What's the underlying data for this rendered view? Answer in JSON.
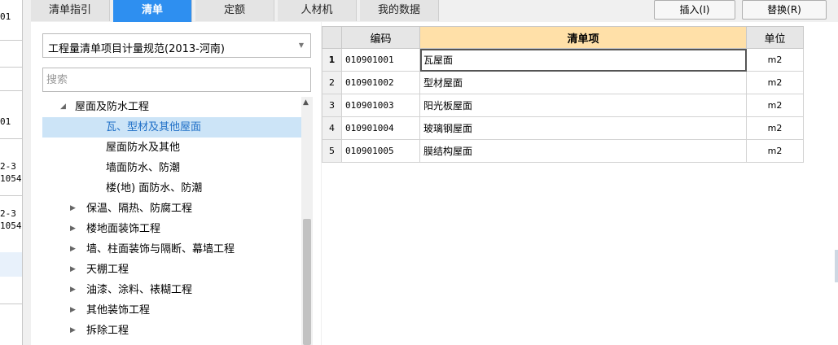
{
  "left_strip": [
    "01",
    "01",
    "2-3",
    "1054",
    "2-3",
    "1054"
  ],
  "tabs": [
    {
      "label": "清单指引"
    },
    {
      "label": "清单"
    },
    {
      "label": "定额"
    },
    {
      "label": "人材机"
    },
    {
      "label": "我的数据"
    }
  ],
  "active_tab": "清单",
  "toolbar": {
    "insert_label": "插入(I)",
    "replace_label": "替换(R)"
  },
  "norm_select": {
    "value": "工程量清单项目计量规范(2013-河南)"
  },
  "search": {
    "placeholder": "搜索"
  },
  "tree": [
    {
      "label": "屋面及防水工程",
      "expanded": true
    },
    {
      "label": "瓦、型材及其他屋面",
      "selected": true
    },
    {
      "label": "屋面防水及其他"
    },
    {
      "label": "墙面防水、防潮"
    },
    {
      "label": "楼(地) 面防水、防潮"
    },
    {
      "label": "保温、隔热、防腐工程"
    },
    {
      "label": "楼地面装饰工程"
    },
    {
      "label": "墙、柱面装饰与隔断、幕墙工程"
    },
    {
      "label": "天棚工程"
    },
    {
      "label": "油漆、涂料、裱糊工程"
    },
    {
      "label": "其他装饰工程"
    },
    {
      "label": "拆除工程"
    }
  ],
  "grid": {
    "headers": {
      "code": "编码",
      "item": "清单项",
      "unit": "单位"
    },
    "rows": [
      {
        "n": "1",
        "code": "010901001",
        "name": "瓦屋面",
        "unit": "m2"
      },
      {
        "n": "2",
        "code": "010901002",
        "name": "型材屋面",
        "unit": "m2"
      },
      {
        "n": "3",
        "code": "010901003",
        "name": "阳光板屋面",
        "unit": "m2"
      },
      {
        "n": "4",
        "code": "010901004",
        "name": "玻璃钢屋面",
        "unit": "m2"
      },
      {
        "n": "5",
        "code": "010901005",
        "name": "膜结构屋面",
        "unit": "m2"
      }
    ]
  },
  "colors": {
    "accent": "#2e8ff0",
    "header_highlight": "#ffe0a8",
    "tree_selected": "#cce4f7"
  }
}
